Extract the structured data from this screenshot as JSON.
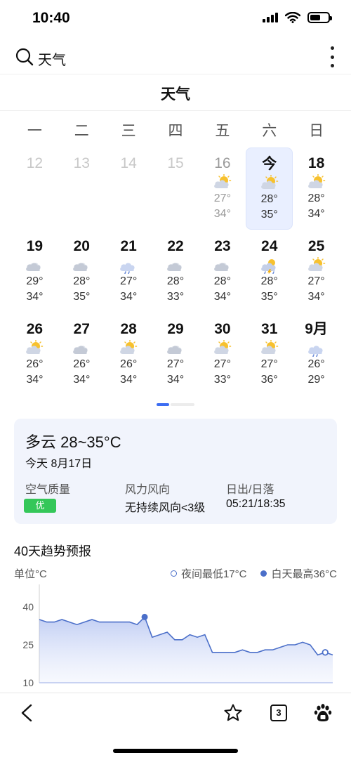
{
  "status": {
    "time": "10:40"
  },
  "search": {
    "query": "天气"
  },
  "page": {
    "title": "天气"
  },
  "weekdays": [
    "一",
    "二",
    "三",
    "四",
    "五",
    "六",
    "日"
  ],
  "calendar": {
    "rows": [
      [
        {
          "day": "12",
          "state": "blank"
        },
        {
          "day": "13",
          "state": "blank"
        },
        {
          "day": "14",
          "state": "blank"
        },
        {
          "day": "15",
          "state": "blank"
        },
        {
          "day": "16",
          "state": "past",
          "icon": "partly-cloudy-icon",
          "low": "27°",
          "high": "34°"
        },
        {
          "day": "今",
          "state": "today",
          "icon": "partly-cloudy-icon",
          "low": "28°",
          "high": "35°"
        },
        {
          "day": "18",
          "state": "future",
          "icon": "partly-cloudy-icon",
          "low": "28°",
          "high": "34°"
        }
      ],
      [
        {
          "day": "19",
          "state": "future",
          "icon": "cloudy-icon",
          "low": "29°",
          "high": "34°"
        },
        {
          "day": "20",
          "state": "future",
          "icon": "cloudy-icon",
          "low": "28°",
          "high": "35°"
        },
        {
          "day": "21",
          "state": "future",
          "icon": "rain-icon",
          "low": "27°",
          "high": "34°"
        },
        {
          "day": "22",
          "state": "future",
          "icon": "cloudy-icon",
          "low": "28°",
          "high": "33°"
        },
        {
          "day": "23",
          "state": "future",
          "icon": "cloudy-icon",
          "low": "28°",
          "high": "34°"
        },
        {
          "day": "24",
          "state": "future",
          "icon": "thunderstorm-icon",
          "low": "28°",
          "high": "35°"
        },
        {
          "day": "25",
          "state": "future",
          "icon": "partly-cloudy-icon",
          "low": "27°",
          "high": "34°"
        }
      ],
      [
        {
          "day": "26",
          "state": "future",
          "icon": "partly-cloudy-icon",
          "low": "26°",
          "high": "34°"
        },
        {
          "day": "27",
          "state": "future",
          "icon": "cloudy-icon",
          "low": "26°",
          "high": "34°"
        },
        {
          "day": "28",
          "state": "future",
          "icon": "partly-cloudy-icon",
          "low": "26°",
          "high": "34°"
        },
        {
          "day": "29",
          "state": "future",
          "icon": "cloudy-icon",
          "low": "27°",
          "high": "34°"
        },
        {
          "day": "30",
          "state": "future",
          "icon": "partly-cloudy-icon",
          "low": "27°",
          "high": "33°"
        },
        {
          "day": "31",
          "state": "future",
          "icon": "partly-cloudy-icon",
          "low": "27°",
          "high": "36°"
        },
        {
          "day": "9月",
          "state": "future",
          "icon": "rain-icon",
          "low": "26°",
          "high": "29°"
        }
      ]
    ]
  },
  "summary": {
    "condition": "多云 28~35°C",
    "date": "今天 8月17日",
    "aqi_label": "空气质量",
    "aqi_value": "优",
    "wind_label": "风力风向",
    "wind_value": "无持续风向<3级",
    "sun_label": "日出/日落",
    "sun_value": "05:21/18:35"
  },
  "trend": {
    "title": "40天趋势预报",
    "unit": "单位°C",
    "legend_low": "夜间最低17°C",
    "legend_high": "白天最高36°C"
  },
  "chart_data": {
    "type": "area",
    "yticks": [
      "40",
      "25",
      "10"
    ],
    "ylim": [
      10,
      45
    ],
    "grid": false,
    "legend": "top-right",
    "series": [
      {
        "name": "白天最高36°C",
        "values": [
          35,
          34,
          34,
          35,
          34,
          33,
          34,
          35,
          34,
          34,
          34,
          34,
          34,
          33,
          36,
          28,
          29,
          30,
          27,
          27,
          29,
          28,
          29,
          22,
          22,
          22,
          22,
          23,
          22,
          22,
          23,
          23,
          24,
          25,
          25,
          26,
          25,
          21,
          22,
          21
        ],
        "markers": [
          {
            "index": 14,
            "style": "solid"
          },
          {
            "index": 38,
            "style": "outline"
          }
        ]
      }
    ],
    "color": "#4b6fc9"
  },
  "toolbar": {
    "tab_count": "3"
  },
  "colors": {
    "accent": "#3d6df2",
    "card_bg": "#f1f4fc",
    "aqi_good": "#34c759",
    "today_bg": "#e9efff"
  }
}
